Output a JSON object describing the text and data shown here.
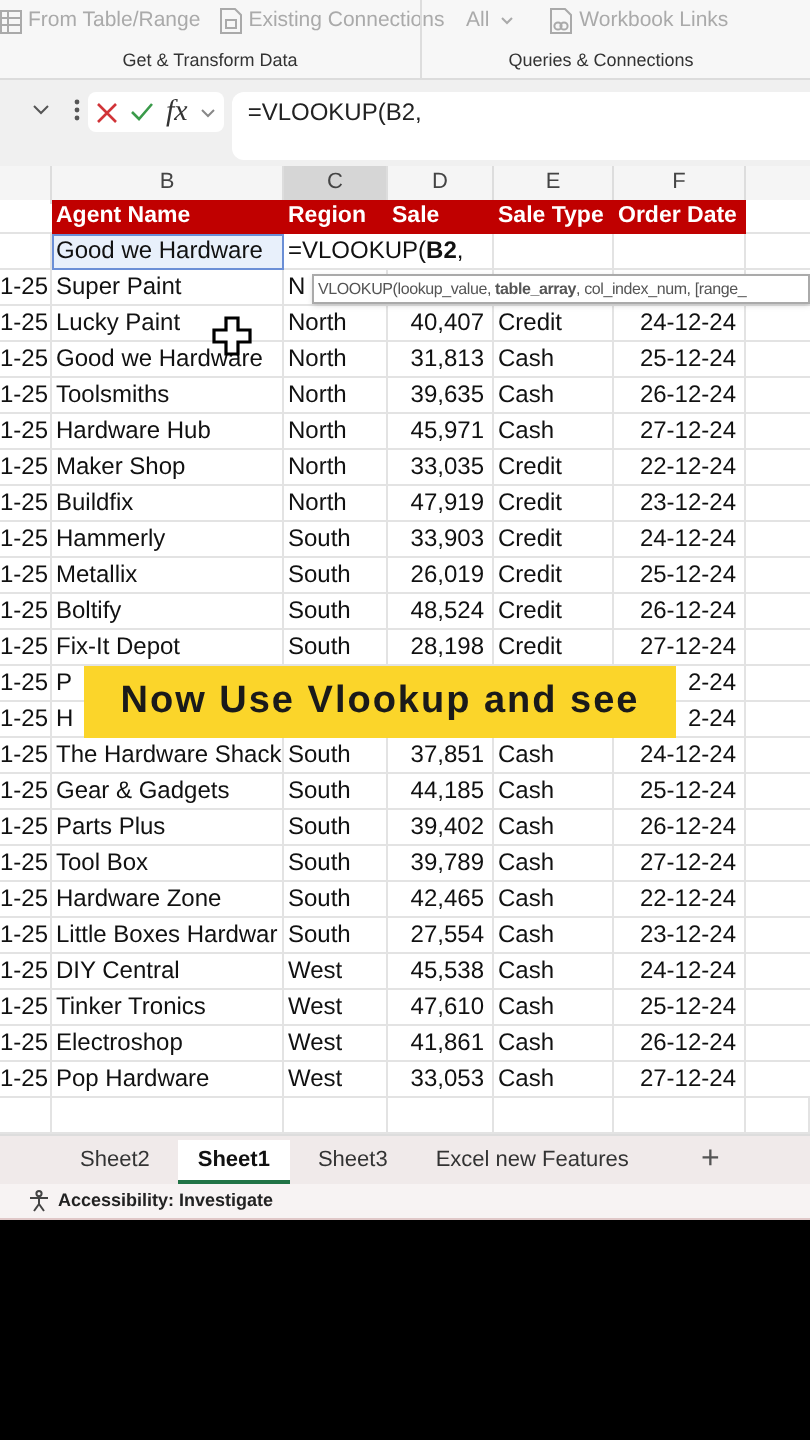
{
  "ribbon": {
    "groups": [
      {
        "title": "Get & Transform Data",
        "items": [
          {
            "kind": "table",
            "label": "From Table/Range"
          },
          {
            "kind": "document",
            "label": "Existing Connections"
          }
        ]
      },
      {
        "title": "Queries & Connections",
        "items": [
          {
            "kind": "dropdown",
            "label": "All"
          },
          {
            "kind": "links",
            "label": "Workbook Links"
          }
        ]
      }
    ]
  },
  "formula_bar": {
    "function_label": "fx",
    "formula": "=VLOOKUP(B2,"
  },
  "column_headers": [
    {
      "label": "B",
      "selected": false
    },
    {
      "label": "C",
      "selected": true
    },
    {
      "label": "D",
      "selected": false
    },
    {
      "label": "E",
      "selected": false
    },
    {
      "label": "F",
      "selected": false
    }
  ],
  "table_header": [
    "Agent Name",
    "Region",
    "Sale",
    "Sale Type",
    "Order Date"
  ],
  "entry_row": {
    "agent": "Good we Hardware",
    "formula": "=VLOOKUP(**B2**,"
  },
  "tooltip": "VLOOKUP(lookup_value, **table_array**, col_index_num, [range_",
  "rows": [
    {
      "a": "1-25",
      "agent": "Super Paint",
      "region": "N"
    },
    {
      "a": "1-25",
      "agent": "Lucky Paint",
      "region": "North",
      "sale": "40,407",
      "type": "Credit",
      "date": "24-12-24"
    },
    {
      "a": "1-25",
      "agent": "Good we Hardware",
      "region": "North",
      "sale": "31,813",
      "type": "Cash",
      "date": "25-12-24"
    },
    {
      "a": "1-25",
      "agent": "Toolsmiths",
      "region": "North",
      "sale": "39,635",
      "type": "Cash",
      "date": "26-12-24"
    },
    {
      "a": "1-25",
      "agent": "Hardware Hub",
      "region": "North",
      "sale": "45,971",
      "type": "Cash",
      "date": "27-12-24"
    },
    {
      "a": "1-25",
      "agent": "Maker Shop",
      "region": "North",
      "sale": "33,035",
      "type": "Credit",
      "date": "22-12-24"
    },
    {
      "a": "1-25",
      "agent": "Buildfix",
      "region": "North",
      "sale": "47,919",
      "type": "Credit",
      "date": "23-12-24"
    },
    {
      "a": "1-25",
      "agent": "Hammerly",
      "region": "South",
      "sale": "33,903",
      "type": "Credit",
      "date": "24-12-24"
    },
    {
      "a": "1-25",
      "agent": "Metallix",
      "region": "South",
      "sale": "26,019",
      "type": "Credit",
      "date": "25-12-24"
    },
    {
      "a": "1-25",
      "agent": "Boltify",
      "region": "South",
      "sale": "48,524",
      "type": "Credit",
      "date": "26-12-24"
    },
    {
      "a": "1-25",
      "agent": "Fix-It Depot",
      "region": "South",
      "sale": "28,198",
      "type": "Credit",
      "date": "27-12-24"
    },
    {
      "a": "1-25",
      "agent": "P",
      "date": "2-24"
    },
    {
      "a": "1-25",
      "agent": "H",
      "date": "2-24"
    },
    {
      "a": "1-25",
      "agent": "The Hardware Shack",
      "region": "South",
      "sale": "37,851",
      "type": "Cash",
      "date": "24-12-24"
    },
    {
      "a": "1-25",
      "agent": "Gear & Gadgets",
      "region": "South",
      "sale": "44,185",
      "type": "Cash",
      "date": "25-12-24"
    },
    {
      "a": "1-25",
      "agent": "Parts Plus",
      "region": "South",
      "sale": "39,402",
      "type": "Cash",
      "date": "26-12-24"
    },
    {
      "a": "1-25",
      "agent": "Tool Box",
      "region": "South",
      "sale": "39,789",
      "type": "Cash",
      "date": "27-12-24"
    },
    {
      "a": "1-25",
      "agent": "Hardware Zone",
      "region": "South",
      "sale": "42,465",
      "type": "Cash",
      "date": "22-12-24"
    },
    {
      "a": "1-25",
      "agent": "Little Boxes Hardwar",
      "region": "South",
      "sale": "27,554",
      "type": "Cash",
      "date": "23-12-24"
    },
    {
      "a": "1-25",
      "agent": "DIY Central",
      "region": "West",
      "sale": "45,538",
      "type": "Cash",
      "date": "24-12-24"
    },
    {
      "a": "1-25",
      "agent": "Tinker Tronics",
      "region": "West",
      "sale": "47,610",
      "type": "Cash",
      "date": "25-12-24"
    },
    {
      "a": "1-25",
      "agent": "Electroshop",
      "region": "West",
      "sale": "41,861",
      "type": "Cash",
      "date": "26-12-24"
    },
    {
      "a": "1-25",
      "agent": "Pop Hardware",
      "region": "West",
      "sale": "33,053",
      "type": "Cash",
      "date": "27-12-24"
    }
  ],
  "caption": "Now Use Vlookup and see",
  "sheet_tabs": [
    {
      "label": "Sheet2",
      "selected": false
    },
    {
      "label": "Sheet1",
      "selected": true
    },
    {
      "label": "Sheet3",
      "selected": false
    },
    {
      "label": "Excel new Features",
      "selected": false
    }
  ],
  "add_sheet": "+",
  "status_bar": {
    "accessibility": "Accessibility: Investigate"
  }
}
